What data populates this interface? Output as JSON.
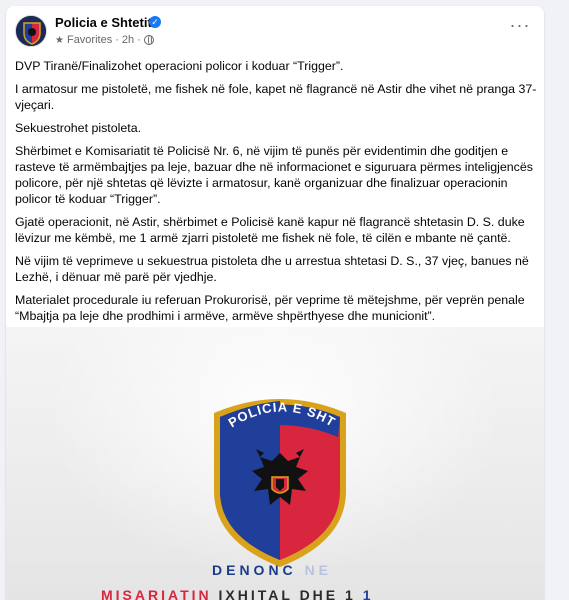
{
  "post": {
    "author": "Policia e Shtetit",
    "verified": true,
    "audience_label": "Favorites",
    "time": "2h",
    "separator": "·",
    "more_label": "···",
    "paragraphs": [
      "DVP Tiranë/Finalizohet operacioni policor i koduar “Trigger”.",
      "I armatosur me pistoletë, me fishek në fole, kapet në flagrancë në Astir dhe vihet në pranga 37-vjeçari.",
      "Sekuestrohet pistoleta.",
      "Shërbimet e Komisariatit të Policisë Nr. 6, në vijim të punës për evidentimin dhe goditjen e rasteve të armëmbajtjes pa leje, bazuar dhe në informacionet e siguruara përmes inteligjencës policore, për një shtetas që lëvizte i armatosur, kanë organizuar dhe finalizuar operacionin policor të koduar “Trigger”.",
      "Gjatë operacionit, në Astir, shërbimet e Policisë kanë kapur në flagrancë shtetasin D. S. duke lëvizur me këmbë, me 1 armë zjarri pistoletë me fishek në fole, të cilën e mbante në çantë.",
      "Në vijim të veprimeve u sekuestrua pistoleta dhe u arrestua shtetasi D. S., 37 vjeç, banues në Lezhë, i dënuar më parë për vjedhje.",
      "Materialet procedurale iu referuan Prokurorisë, për veprime të mëtejshme, për veprën penale “Mbajtja pa leje dhe prodhimi i armëve, armëve shpërthyese dhe municionit”."
    ]
  },
  "media": {
    "badge_text": "POLICIA E SHTETIT",
    "overlay_line1_a": "DENONC",
    "overlay_line1_b": "NE",
    "overlay_line2_a": "MISARIATIN",
    "overlay_line2_b": "IXHITAL",
    "overlay_line2_c": "DHE 1",
    "overlay_line2_d": "1",
    "colors": {
      "shield_blue": "#1f3f9b",
      "shield_red": "#d7263d",
      "gold": "#d9a21b",
      "eagle": "#111111"
    }
  },
  "colors": {
    "link_blue": "#1877f2",
    "secondary_text": "#65676b"
  }
}
